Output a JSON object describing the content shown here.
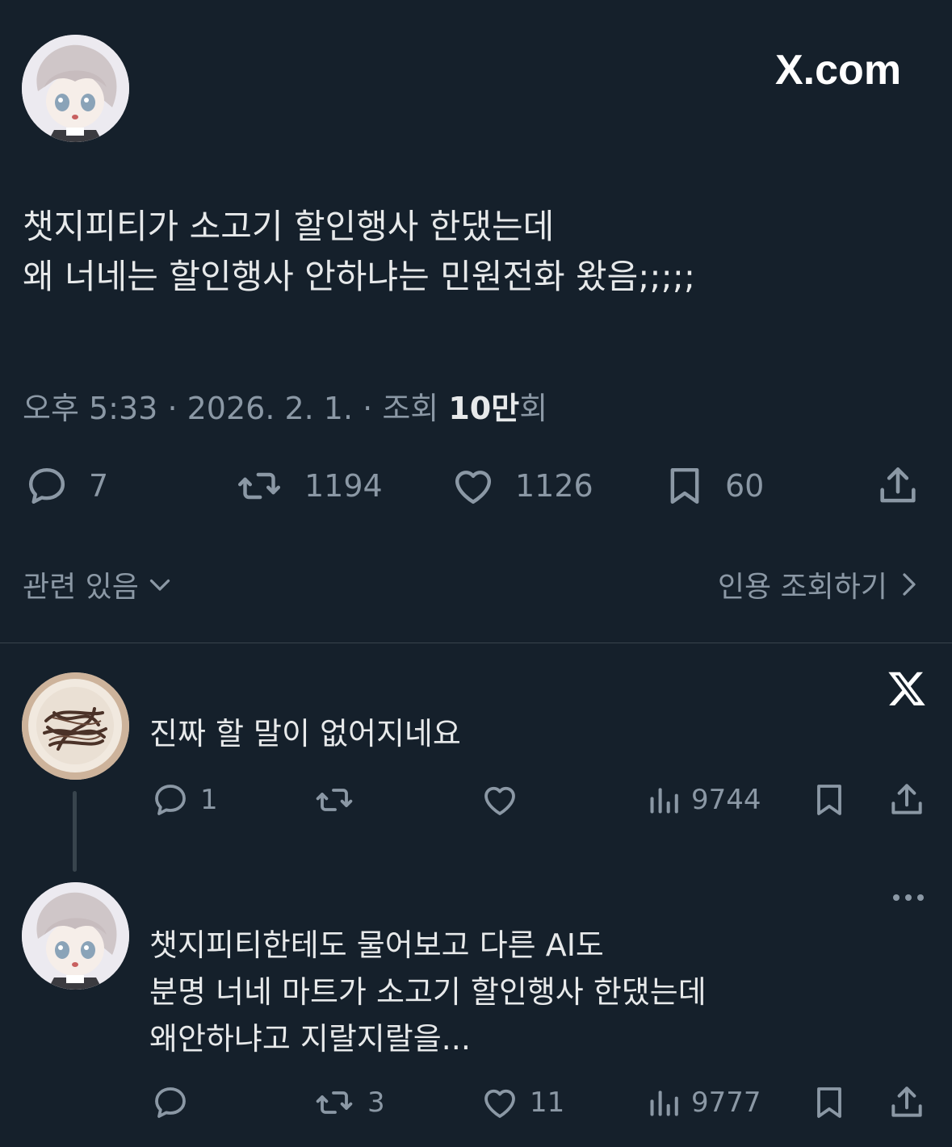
{
  "site_label": "X.com",
  "post": {
    "lines": [
      "챗지피티가 소고기 할인행사 한댔는데",
      "왜 너네는 할인행사 안하냐는 민원전화 왔음;;;;;"
    ],
    "time": "오후 5:33",
    "date": "2026. 2. 1.",
    "views_label": "조회",
    "views_count": "10만",
    "views_suffix": "회",
    "replies": "7",
    "reposts": "1194",
    "likes": "1126",
    "bookmarks": "60",
    "related_label": "관련 있음",
    "quotes_label": "인용 조회하기"
  },
  "replies": [
    {
      "lines": [
        "진짜 할 말이 없어지네요"
      ],
      "replies": "1",
      "reposts": "",
      "likes": "",
      "views": "9744"
    },
    {
      "lines": [
        "챗지피티한테도 물어보고 다른 AI도",
        "분명 너네 마트가 소고기 할인행사 한댔는데",
        "왜안하냐고 지랄지랄을..."
      ],
      "replies": "",
      "reposts": "3",
      "likes": "11",
      "views": "9777"
    }
  ],
  "colors": {
    "background": "#15202b",
    "text": "#e7e9ea",
    "muted": "#8b98a5",
    "divider": "#38444d"
  }
}
